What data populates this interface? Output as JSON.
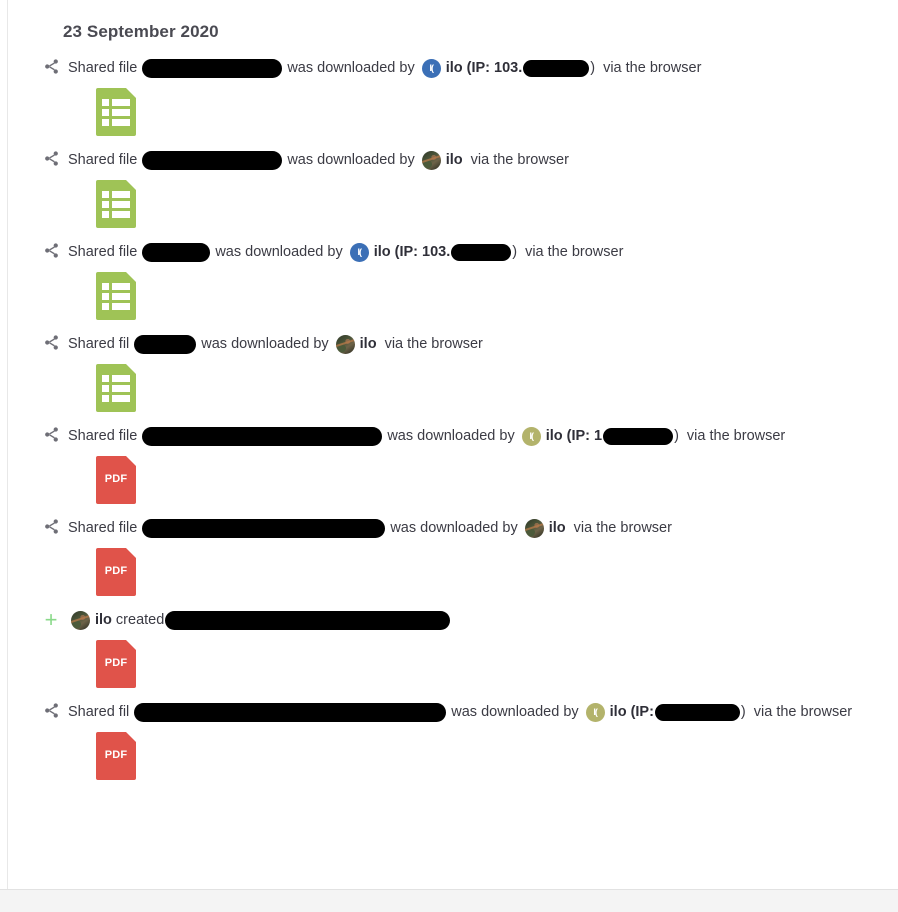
{
  "page": {
    "day_heading": "23 September 2020",
    "colors": {
      "sheet_icon": "#9fc356",
      "pdf_icon": "#e0534a",
      "avatar_blue": "#3b6fb6",
      "avatar_olive": "#b3b36b",
      "plus_icon": "#8ad98a",
      "share_icon": "#6e6e76",
      "heading_text": "#4a4a52",
      "body_text": "#3b3b44",
      "footer_strip": "#f4f4f4"
    },
    "labels": {
      "shared_file": "Shared file",
      "was_downloaded_by": "was downloaded by",
      "via_the_browser": "via the browser",
      "created": "created",
      "ip_prefix_open": "(IP:",
      "paren_close": ")",
      "user_name": "ilo",
      "pdf_label": "PDF"
    },
    "activities": [
      {
        "id": "activity-1",
        "gutter_icon": "share-icon",
        "kind": "download",
        "prefix": "Shared file",
        "redact_before_width": 140,
        "middle": "was downloaded by",
        "avatar": {
          "type": "initials",
          "color": "blue",
          "text": "I("
        },
        "actor": "ilo",
        "ip_label": "(IP: 103.",
        "redact_ip_width": 66,
        "ip_close": ")",
        "suffix": "via the browser",
        "file": {
          "type": "spreadsheet",
          "label": ""
        }
      },
      {
        "id": "activity-2",
        "gutter_icon": "share-icon",
        "kind": "download",
        "prefix": "Shared file",
        "redact_before_width": 140,
        "middle": "was downloaded by",
        "avatar": {
          "type": "photo",
          "color": "photo",
          "text": ""
        },
        "actor": "ilo",
        "ip_label": "",
        "redact_ip_width": 0,
        "ip_close": "",
        "suffix": "via the browser",
        "file": {
          "type": "spreadsheet",
          "label": ""
        }
      },
      {
        "id": "activity-3",
        "gutter_icon": "share-icon",
        "kind": "download",
        "prefix": "Shared file",
        "redact_before_width": 68,
        "middle": "was downloaded by",
        "avatar": {
          "type": "initials",
          "color": "blue",
          "text": "I("
        },
        "actor": "ilo",
        "ip_label": "(IP: 103.",
        "redact_ip_width": 60,
        "ip_close": ")",
        "suffix": "via the browser",
        "file": {
          "type": "spreadsheet",
          "label": ""
        }
      },
      {
        "id": "activity-4",
        "gutter_icon": "share-icon",
        "kind": "download",
        "prefix": "Shared fil",
        "redact_before_width": 62,
        "middle": "was downloaded by",
        "avatar": {
          "type": "photo",
          "color": "photo",
          "text": ""
        },
        "actor": "ilo",
        "ip_label": "",
        "redact_ip_width": 0,
        "ip_close": "",
        "suffix": "via the browser",
        "file": {
          "type": "spreadsheet",
          "label": ""
        }
      },
      {
        "id": "activity-5",
        "gutter_icon": "share-icon",
        "kind": "download",
        "prefix": "Shared file",
        "redact_before_width": 240,
        "middle": "was downloaded by",
        "avatar": {
          "type": "initials",
          "color": "olive",
          "text": "I("
        },
        "actor": "ilo",
        "ip_label": "(IP: 1",
        "redact_ip_width": 70,
        "ip_close": ")",
        "suffix": "via the browser",
        "file": {
          "type": "pdf",
          "label": "PDF"
        }
      },
      {
        "id": "activity-6",
        "gutter_icon": "share-icon",
        "kind": "download",
        "prefix": "Shared file",
        "redact_before_width": 243,
        "middle": "was downloaded by",
        "avatar": {
          "type": "photo",
          "color": "photo",
          "text": ""
        },
        "actor": "ilo",
        "ip_label": "",
        "redact_ip_width": 0,
        "ip_close": "",
        "suffix": "via the browser",
        "file": {
          "type": "pdf",
          "label": "PDF"
        }
      },
      {
        "id": "activity-7",
        "gutter_icon": "plus-icon",
        "kind": "create",
        "prefix": "",
        "redact_before_width": 0,
        "middle": "created",
        "avatar": {
          "type": "photo",
          "color": "photo",
          "text": ""
        },
        "actor": "ilo",
        "ip_label": "",
        "redact_ip_width": 285,
        "ip_close": "",
        "suffix": "",
        "file": {
          "type": "pdf",
          "label": "PDF"
        }
      },
      {
        "id": "activity-8",
        "gutter_icon": "share-icon",
        "kind": "download",
        "prefix": "Shared fil",
        "redact_before_width": 312,
        "middle": "was downloaded by",
        "avatar": {
          "type": "initials",
          "color": "olive",
          "text": "I("
        },
        "actor": "ilo",
        "ip_label": "(IP:",
        "redact_ip_width": 85,
        "ip_close": ")",
        "suffix": "via the browser",
        "file": {
          "type": "pdf",
          "label": "PDF"
        }
      }
    ]
  }
}
